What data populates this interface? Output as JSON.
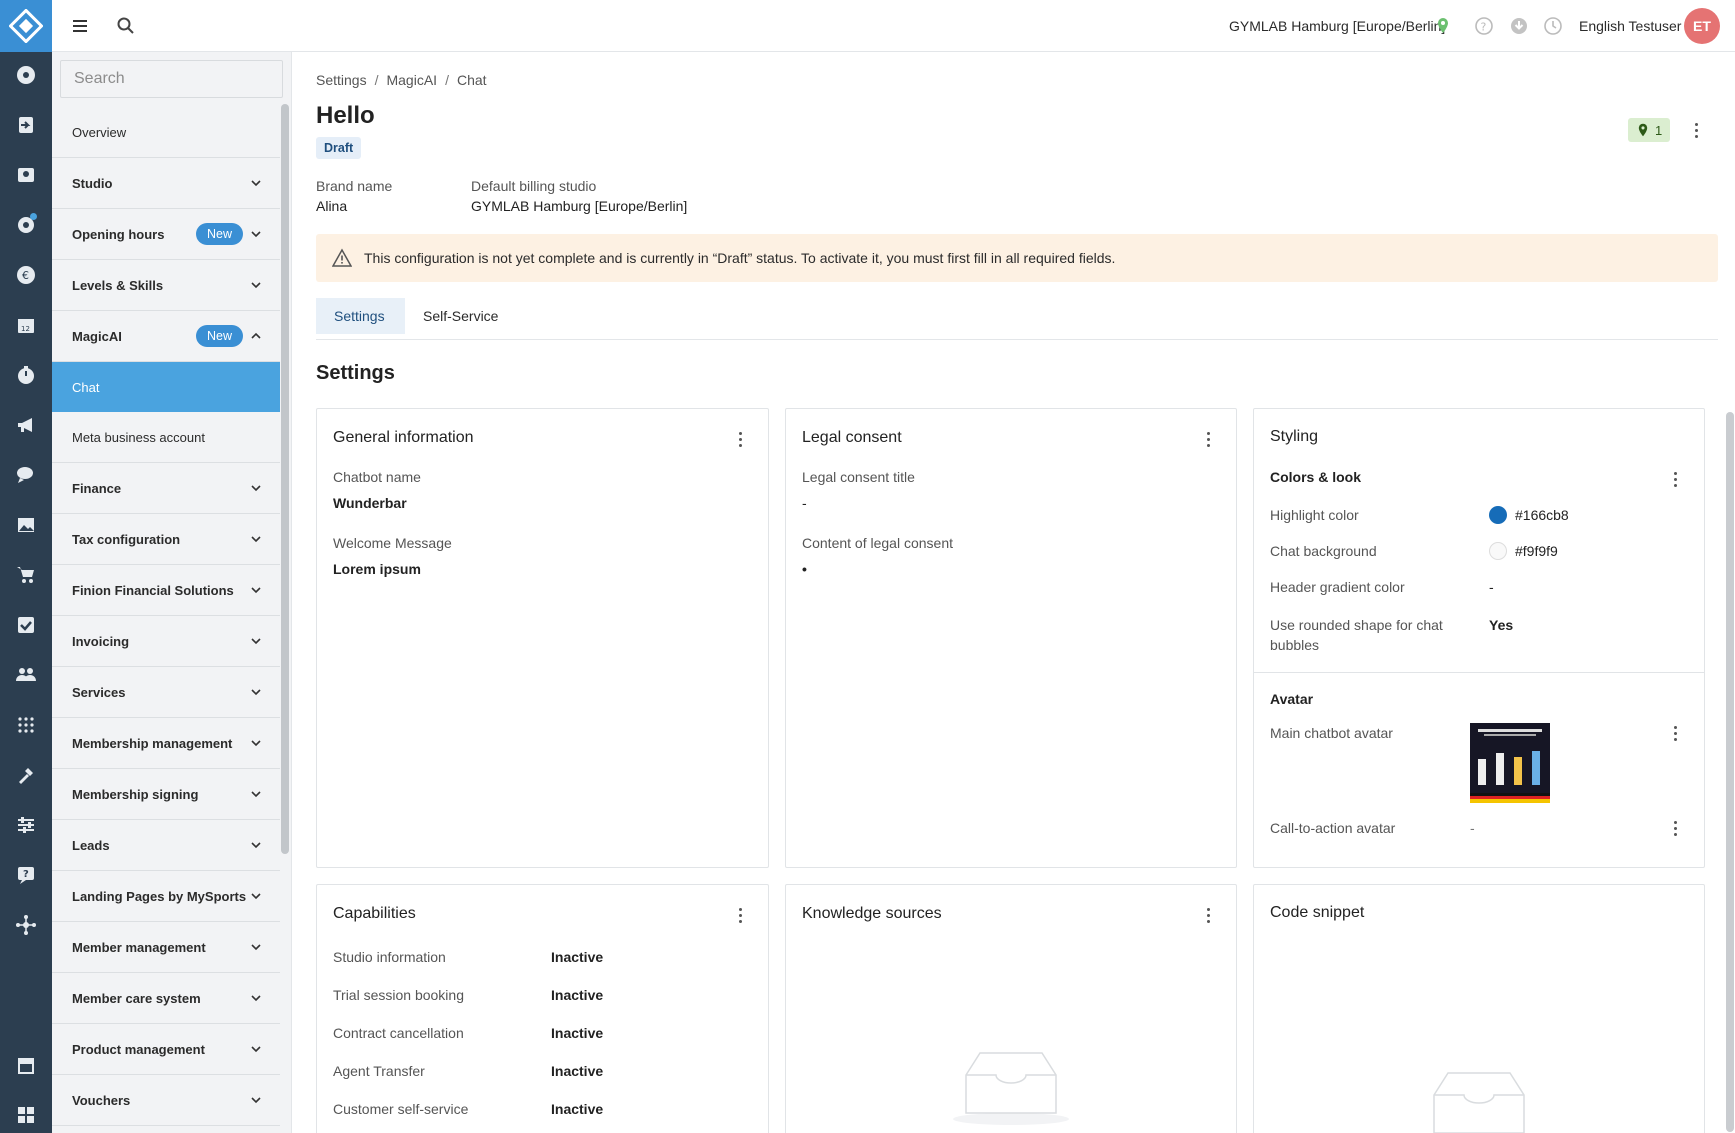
{
  "topbar": {
    "studio": "GYMLAB Hamburg [Europe/Berlin]",
    "user": "English Testuser",
    "avatar_initials": "ET"
  },
  "sidebar": {
    "search_placeholder": "Search",
    "items": [
      {
        "label": "Overview"
      },
      {
        "label": "Studio"
      },
      {
        "label": "Opening hours",
        "badge": "New"
      },
      {
        "label": "Levels & Skills"
      },
      {
        "label": "MagicAI",
        "badge": "New"
      },
      {
        "label": "Chat"
      },
      {
        "label": "Meta business account"
      },
      {
        "label": "Finance"
      },
      {
        "label": "Tax configuration"
      },
      {
        "label": "Finion Financial Solutions"
      },
      {
        "label": "Invoicing"
      },
      {
        "label": "Services"
      },
      {
        "label": "Membership management"
      },
      {
        "label": "Membership signing"
      },
      {
        "label": "Leads"
      },
      {
        "label": "Landing Pages by MySports"
      },
      {
        "label": "Member management"
      },
      {
        "label": "Member care system"
      },
      {
        "label": "Product management"
      },
      {
        "label": "Vouchers"
      }
    ]
  },
  "breadcrumb": [
    "Settings",
    "MagicAI",
    "Chat"
  ],
  "page": {
    "title": "Hello",
    "status": "Draft",
    "location_count": "1",
    "brand_label": "Brand name",
    "brand_value": "Alina",
    "billing_label": "Default billing studio",
    "billing_value": "GYMLAB Hamburg [Europe/Berlin]",
    "warning": "This configuration is not yet complete and is currently in “Draft” status. To activate it, you must first fill in all required fields."
  },
  "tabs": [
    "Settings",
    "Self-Service"
  ],
  "section_title": "Settings",
  "general": {
    "title": "General information",
    "name_label": "Chatbot name",
    "name_value": "Wunderbar",
    "welcome_label": "Welcome Message",
    "welcome_value": "Lorem ipsum"
  },
  "legal": {
    "title": "Legal consent",
    "title_label": "Legal consent title",
    "title_value": "-",
    "content_label": "Content of legal consent",
    "content_value": "•"
  },
  "styling": {
    "title": "Styling",
    "colors_title": "Colors & look",
    "highlight_label": "Highlight color",
    "highlight_value": "#166cb8",
    "chatbg_label": "Chat background",
    "chatbg_value": "#f9f9f9",
    "gradient_label": "Header gradient color",
    "gradient_value": "-",
    "rounded_label_1": "Use rounded shape for chat",
    "rounded_label_2": "bubbles",
    "rounded_value": "Yes",
    "avatar_title": "Avatar",
    "main_avatar_label": "Main chatbot avatar",
    "cta_avatar_label": "Call-to-action avatar",
    "cta_avatar_value": "-"
  },
  "capabilities": {
    "title": "Capabilities",
    "rows": [
      {
        "label": "Studio information",
        "value": "Inactive"
      },
      {
        "label": "Trial session booking",
        "value": "Inactive"
      },
      {
        "label": "Contract cancellation",
        "value": "Inactive"
      },
      {
        "label": "Agent Transfer",
        "value": "Inactive"
      },
      {
        "label": "Customer self-service",
        "value": "Inactive"
      }
    ]
  },
  "knowledge": {
    "title": "Knowledge sources"
  },
  "snippet": {
    "title": "Code snippet"
  },
  "colors": {
    "rail": "#2c3e50",
    "accent": "#4aa3df",
    "brand_blue": "#3a8fd4",
    "highlight": "#166cb8",
    "chat_background": "#f9f9f9",
    "warning_bg": "#fdf1e3"
  }
}
